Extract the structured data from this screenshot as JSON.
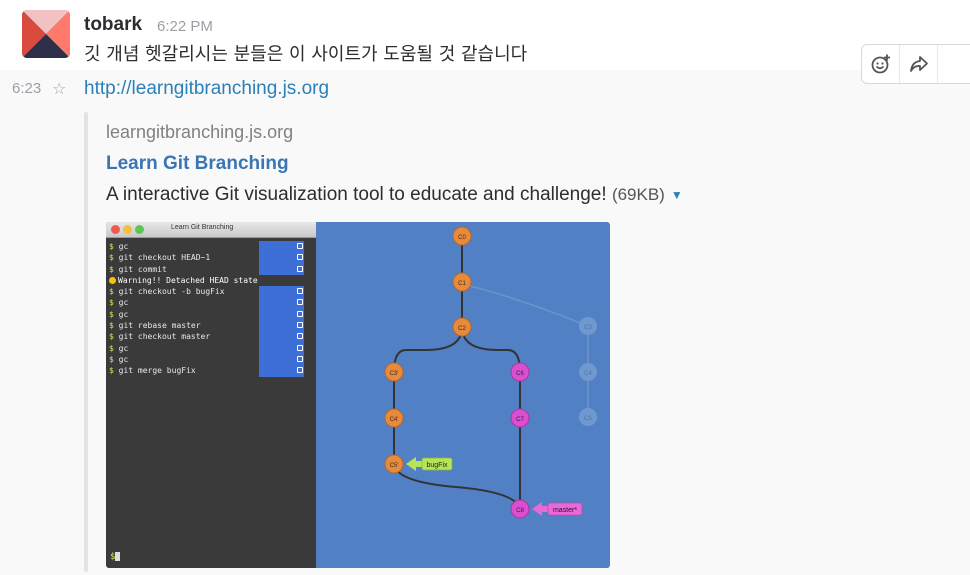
{
  "message": {
    "username": "tobark",
    "time": "6:22 PM",
    "text": "깃 개념 헷갈리시는 분들은 이 사이트가 도움될 것 같습니다"
  },
  "followup": {
    "time": "6:23",
    "link": "http://learngitbranching.js.org"
  },
  "actions": {
    "icons": [
      "add-reaction-icon",
      "share-icon"
    ]
  },
  "attachment": {
    "site": "learngitbranching.js.org",
    "title": "Learn Git Branching",
    "description": "A interactive Git visualization tool to educate and challenge!",
    "size": "(69KB)"
  },
  "preview": {
    "window_title": "Learn Git Branching",
    "terminal_lines": [
      {
        "kind": "cmd",
        "text": "gc",
        "highlight": true
      },
      {
        "kind": "cmd",
        "text": "git checkout HEAD~1",
        "highlight": true
      },
      {
        "kind": "cmd",
        "text": "git commit",
        "highlight": true
      },
      {
        "kind": "warn",
        "text": "Warning!! Detached HEAD state",
        "highlight": false
      },
      {
        "kind": "cmd",
        "text": "git checkout -b bugFix",
        "highlight": true
      },
      {
        "kind": "cmd",
        "text": "gc",
        "highlight": true
      },
      {
        "kind": "cmd",
        "text": "gc",
        "highlight": true
      },
      {
        "kind": "cmd",
        "text": "git rebase master",
        "highlight": true
      },
      {
        "kind": "cmd",
        "text": "git checkout master",
        "highlight": true
      },
      {
        "kind": "cmd",
        "text": "gc",
        "highlight": true
      },
      {
        "kind": "cmd",
        "text": "gc",
        "highlight": true
      },
      {
        "kind": "cmd",
        "text": "git merge bugFix",
        "highlight": true
      }
    ],
    "prompt": "$",
    "commits": {
      "c0": "C0",
      "c1": "C1",
      "c2": "C2",
      "c3p": "C3'",
      "c4p": "C4'",
      "c5p": "C5'",
      "c6": "C6",
      "c7": "C7",
      "c8": "C8",
      "c3": "C3",
      "c4": "C4",
      "c5": "C5"
    },
    "branches": {
      "bugfix": "bugFix",
      "master": "master*"
    },
    "colors": {
      "orange": "#e68a3c",
      "magenta": "#d94fd0",
      "ghost": "#6f98cf",
      "bugfix_label": "#b5e35a",
      "master_label": "#e86ad8"
    }
  }
}
